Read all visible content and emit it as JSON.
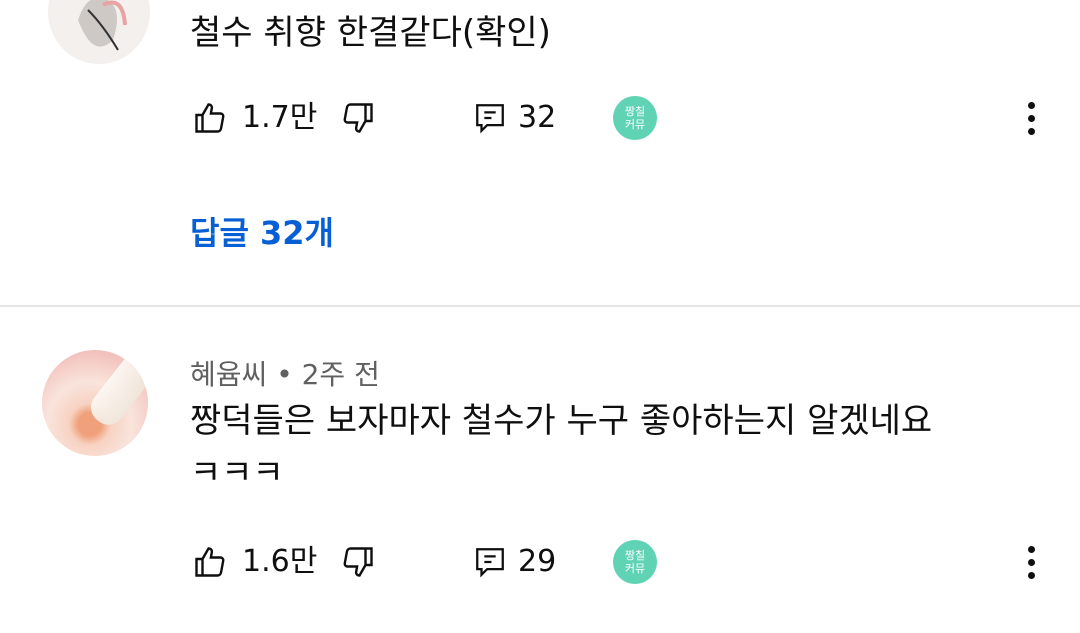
{
  "comments": [
    {
      "text": "철수 취향 한결같다(확인)",
      "likes": "1.7만",
      "replies_count": "32",
      "badge": "짱칠\n커뮤",
      "replies_link": "답글 32개"
    },
    {
      "author": "혜윰씨",
      "separator": "•",
      "time": "2주 전",
      "text_line1": "짱덕들은 보자마자 철수가 누구 좋아하는지 알겠네요",
      "text_line2": "ㅋㅋㅋ",
      "likes": "1.6만",
      "replies_count": "29",
      "badge": "짱칠\n커뮤"
    }
  ],
  "colors": {
    "link": "#065fd4",
    "meta": "#606060",
    "badge": "#5fd3b4"
  },
  "icons": [
    "thumbs-up-icon",
    "thumbs-down-icon",
    "reply-icon",
    "more-vert-icon"
  ]
}
